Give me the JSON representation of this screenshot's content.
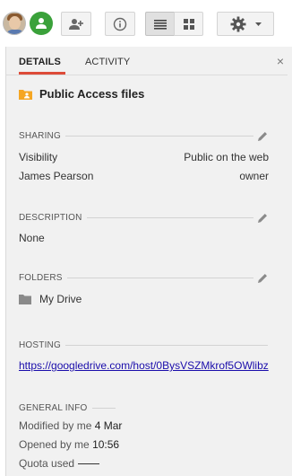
{
  "toolbar": {
    "avatar": "user-avatar",
    "icons": [
      "share-people-icon",
      "add-person-icon",
      "info-icon",
      "list-view-icon",
      "grid-view-icon",
      "gear-icon",
      "caret-down-icon"
    ]
  },
  "panel": {
    "tabs": [
      {
        "label": "DETAILS"
      },
      {
        "label": "ACTIVITY"
      }
    ],
    "close_label": "×",
    "item_title": "Public Access files",
    "sharing": {
      "heading": "SHARING",
      "rows": [
        {
          "left": "Visibility",
          "right": "Public on the web"
        },
        {
          "left": "James Pearson",
          "right": "owner"
        }
      ]
    },
    "description": {
      "heading": "DESCRIPTION",
      "value": "None"
    },
    "folders": {
      "heading": "FOLDERS",
      "value": "My Drive"
    },
    "hosting": {
      "heading": "HOSTING",
      "url": "https://googledrive.com/host/0BysVSZMkrof5OWlibz"
    },
    "general_info": {
      "heading": "GENERAL INFO",
      "modified_label": "Modified by me",
      "modified_value": "4 Mar",
      "opened_label": "Opened by me",
      "opened_value": "10:56",
      "quota_label": "Quota used"
    }
  },
  "colors": {
    "accent_tab": "#dd4b39",
    "share_green": "#3aa13a",
    "link": "#1a0dab",
    "folder_orange": "#f5a623"
  }
}
